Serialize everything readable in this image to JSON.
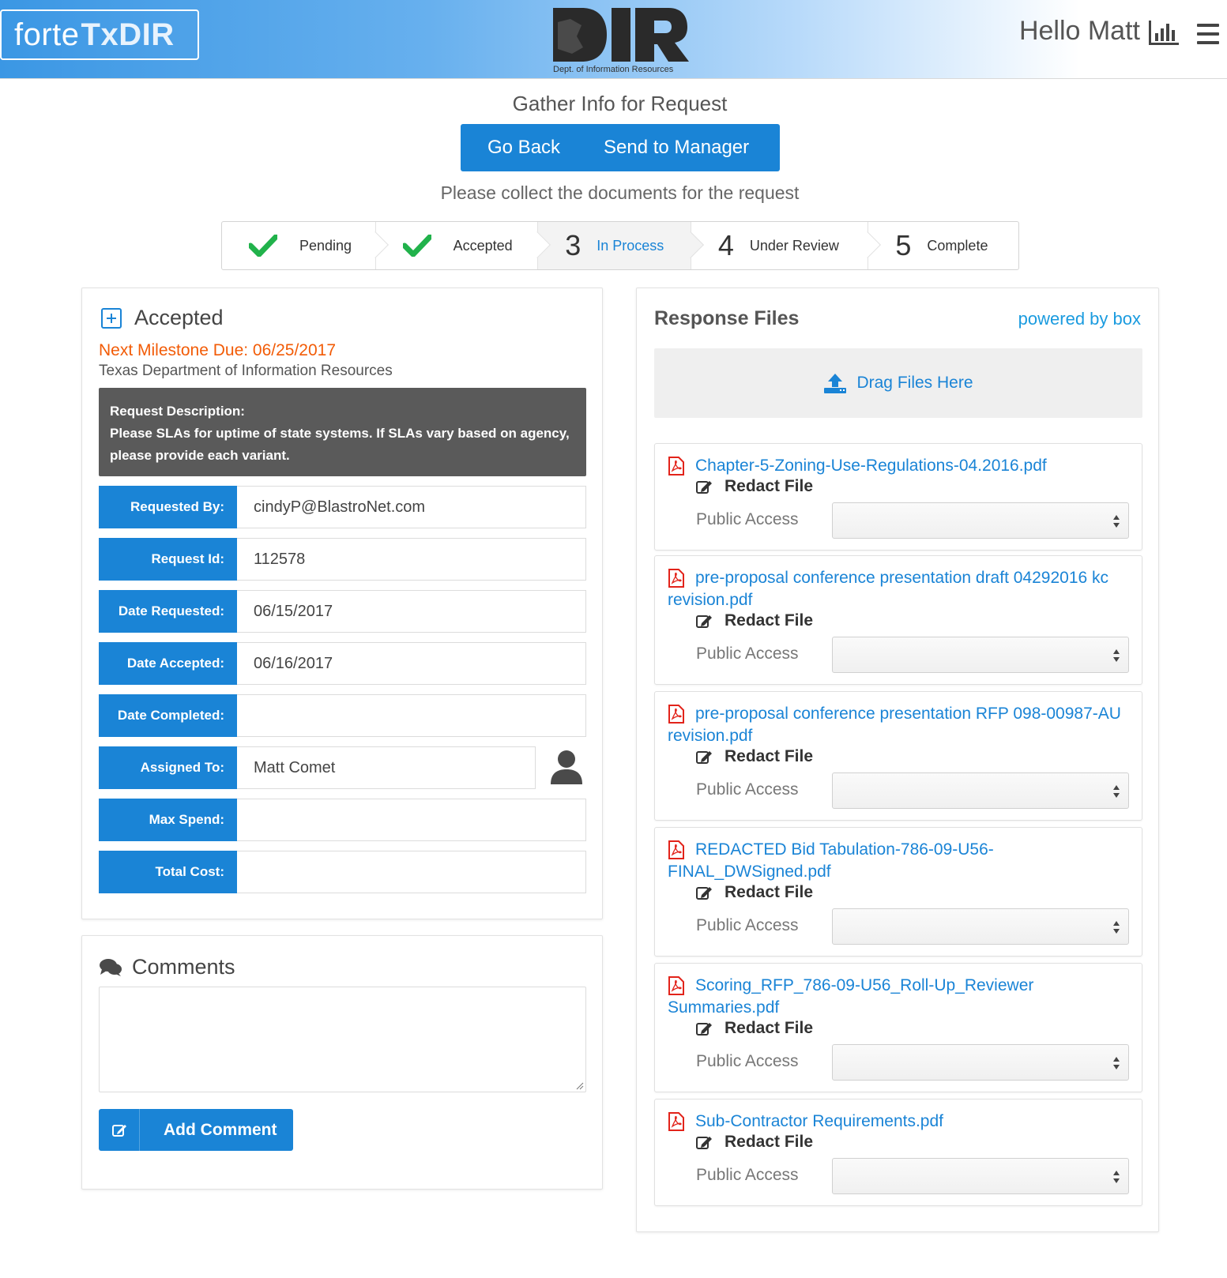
{
  "header": {
    "brand_prefix": "forte",
    "brand_suffix": "TxDIR",
    "logo_text": "DIR",
    "logo_subtitle": "Dept. of Information Resources",
    "greeting": "Hello Matt",
    "chart_icon": "bar-chart-icon",
    "menu_icon": "hamburger-menu-icon"
  },
  "page": {
    "title": "Gather Info for Request",
    "go_back": "Go Back",
    "send_to_manager": "Send to Manager",
    "instructions": "Please collect the documents for the request"
  },
  "steps": [
    {
      "label": "Pending",
      "marker": "check",
      "state": "done"
    },
    {
      "label": "Accepted",
      "marker": "check",
      "state": "done"
    },
    {
      "label": "In Process",
      "marker": "3",
      "state": "active"
    },
    {
      "label": "Under Review",
      "marker": "4",
      "state": "todo"
    },
    {
      "label": "Complete",
      "marker": "5",
      "state": "todo"
    }
  ],
  "request": {
    "status": "Accepted",
    "milestone": "Next Milestone Due: 06/25/2017",
    "agency": "Texas Department of Information Resources",
    "description_label": "Request Description:",
    "description": "Please SLAs for uptime of state systems. If SLAs vary based on agency, please provide each variant.",
    "fields": [
      {
        "label": "Requested By:",
        "value": "cindyP@BlastroNet.com"
      },
      {
        "label": "Request Id:",
        "value": "112578"
      },
      {
        "label": "Date Requested:",
        "value": "06/15/2017"
      },
      {
        "label": "Date Accepted:",
        "value": "06/16/2017"
      },
      {
        "label": "Date Completed:",
        "value": ""
      },
      {
        "label": "Assigned To:",
        "value": "Matt Comet"
      },
      {
        "label": "Max Spend:",
        "value": ""
      },
      {
        "label": "Total Cost:",
        "value": ""
      }
    ]
  },
  "comments": {
    "title": "Comments",
    "value": "",
    "add_label": "Add Comment"
  },
  "response_files": {
    "title": "Response Files",
    "powered_by": "powered by box",
    "dropzone": "Drag Files Here",
    "redact_label": "Redact File",
    "public_access_label": "Public Access",
    "files": [
      {
        "name": "Chapter-5-Zoning-Use-Regulations-04.2016.pdf",
        "public_access": ""
      },
      {
        "name": "pre-proposal conference presentation draft 04292016 kc revision.pdf",
        "public_access": ""
      },
      {
        "name": "pre-proposal conference presentation RFP 098-00987-AU revision.pdf",
        "public_access": ""
      },
      {
        "name": "REDACTED Bid Tabulation-786-09-U56-FINAL_DWSigned.pdf",
        "public_access": ""
      },
      {
        "name": "Scoring_RFP_786-09-U56_Roll-Up_Reviewer Summaries.pdf",
        "public_access": ""
      },
      {
        "name": "Sub-Contractor Requirements.pdf",
        "public_access": ""
      }
    ]
  },
  "colors": {
    "primary": "#1a84d6",
    "link": "#1a84d6",
    "milestone": "#f25b06",
    "success": "#21b24b"
  }
}
